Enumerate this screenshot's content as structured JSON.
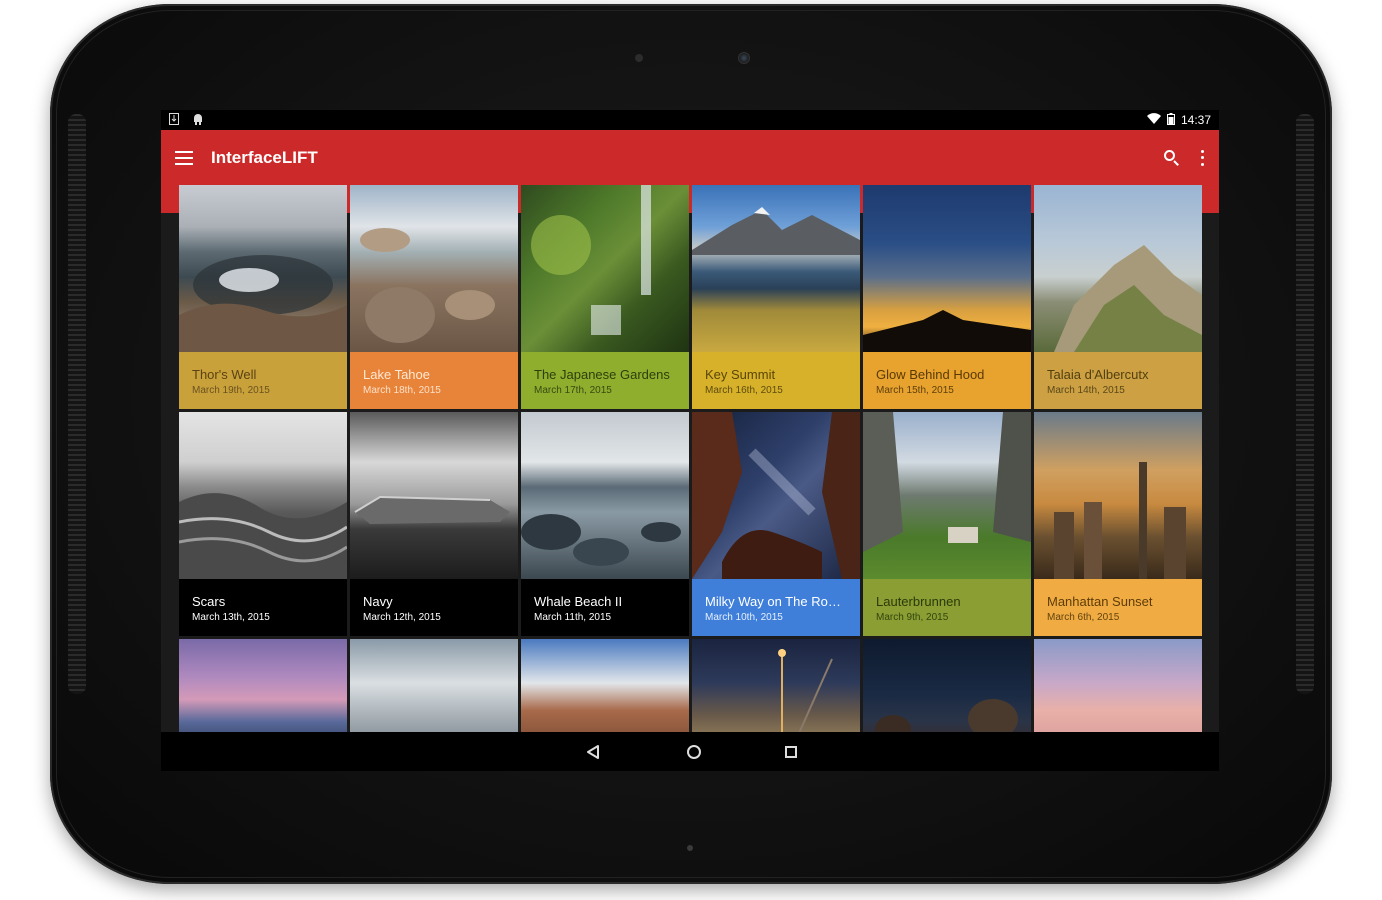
{
  "status_bar": {
    "left_icons": [
      "download-notification-icon",
      "android-notification-icon"
    ],
    "right_icons": [
      "wifi-icon",
      "battery-icon"
    ],
    "time": "14:37"
  },
  "app_bar": {
    "title": "InterfaceLIFT",
    "color": "#cc2a2a",
    "icons": [
      "menu-icon",
      "search-icon",
      "overflow-menu-icon"
    ]
  },
  "wallpapers": [
    {
      "title": "Thor's Well",
      "date": "March 19th, 2015",
      "caption_bg": "#c9a13b",
      "text_color": "#5a4212",
      "date_color": "#6a5220"
    },
    {
      "title": "Lake Tahoe",
      "date": "March 18th, 2015",
      "caption_bg": "#e8843a",
      "text_color": "#ffe8d2",
      "date_color": "#ffe0c8"
    },
    {
      "title": "The Japanese Gardens",
      "date": "March 17th, 2015",
      "caption_bg": "#8fae2e",
      "text_color": "#2e3f0b",
      "date_color": "#384a12"
    },
    {
      "title": "Key Summit",
      "date": "March 16th, 2015",
      "caption_bg": "#d7b12a",
      "text_color": "#5a4608",
      "date_color": "#5e4b0e"
    },
    {
      "title": "Glow Behind Hood",
      "date": "March 15th, 2015",
      "caption_bg": "#e8a22e",
      "text_color": "#5a3a06",
      "date_color": "#5e400c"
    },
    {
      "title": "Talaia d'Albercutx",
      "date": "March 14th, 2015",
      "caption_bg": "#cca043",
      "text_color": "#52400f",
      "date_color": "#5a4818"
    },
    {
      "title": "Scars",
      "date": "March 13th, 2015",
      "caption_bg": "#000000",
      "text_color": "#ffffff",
      "date_color": "#ffffff"
    },
    {
      "title": "Navy",
      "date": "March 12th, 2015",
      "caption_bg": "#000000",
      "text_color": "#ffffff",
      "date_color": "#ffffff"
    },
    {
      "title": "Whale Beach II",
      "date": "March 11th, 2015",
      "caption_bg": "#000000",
      "text_color": "#ffffff",
      "date_color": "#ffffff"
    },
    {
      "title": "Milky Way on The Roc…",
      "date": "March 10th, 2015",
      "caption_bg": "#3f7fd9",
      "text_color": "#ffffff",
      "date_color": "#e6efff"
    },
    {
      "title": "Lauterbrunnen",
      "date": "March 9th, 2015",
      "caption_bg": "#8a9e33",
      "text_color": "#2c3a0a",
      "date_color": "#34440f"
    },
    {
      "title": "Manhattan Sunset",
      "date": "March 6th, 2015",
      "caption_bg": "#f0ac43",
      "text_color": "#5e3c08",
      "date_color": "#62430f"
    }
  ],
  "partial_row_count": 6,
  "nav_bar": {
    "icons": [
      "back-icon",
      "home-icon",
      "recents-icon"
    ]
  }
}
